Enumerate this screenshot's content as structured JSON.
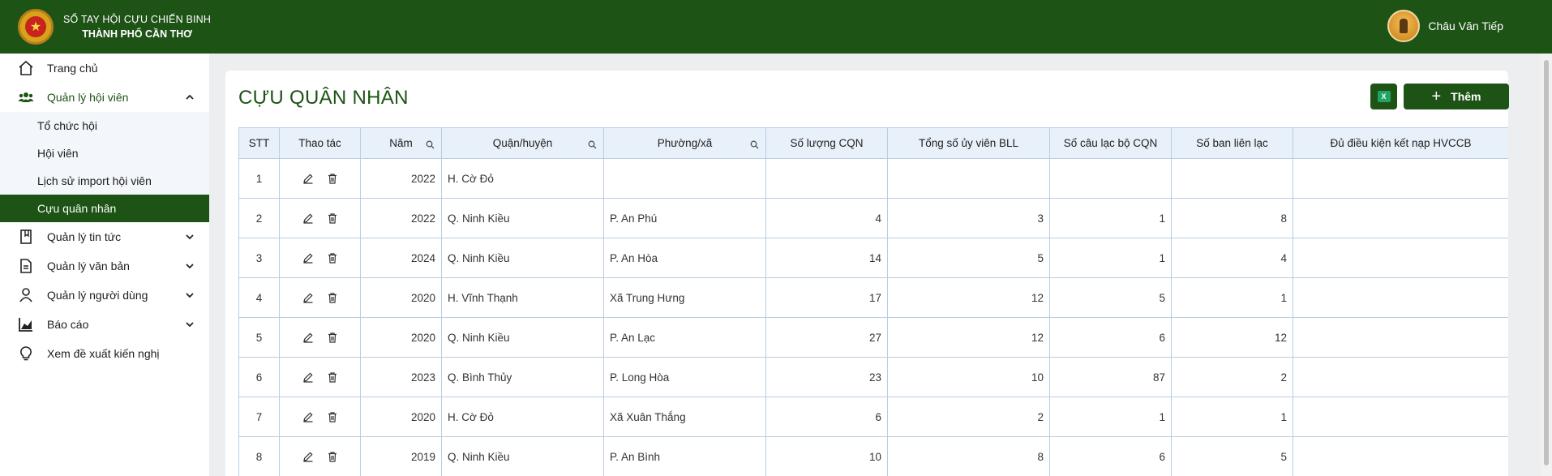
{
  "header": {
    "brand_line1": "SỔ TAY HỘI CỰU CHIẾN BINH",
    "brand_line2": "THÀNH PHỐ CẦN THƠ",
    "user_name": "Châu Văn Tiếp",
    "accent_color": "#1e5316"
  },
  "sidebar": {
    "items": [
      {
        "label": "Trang chủ",
        "icon": "home-icon"
      },
      {
        "label": "Quản lý hội viên",
        "icon": "users-icon",
        "expanded": true
      },
      {
        "label": "Quản lý tin tức",
        "icon": "book-icon"
      },
      {
        "label": "Quản lý văn bản",
        "icon": "document-icon"
      },
      {
        "label": "Quản lý người dùng",
        "icon": "user-icon"
      },
      {
        "label": "Báo cáo",
        "icon": "chart-icon"
      },
      {
        "label": "Xem đề xuất kiến nghị",
        "icon": "lightbulb-icon"
      }
    ],
    "sub_items": [
      {
        "label": "Tổ chức hội"
      },
      {
        "label": "Hội viên"
      },
      {
        "label": "Lịch sử import hội viên"
      },
      {
        "label": "Cựu quân nhân",
        "active": true
      }
    ]
  },
  "main": {
    "title": "CỰU QUÂN NHÂN",
    "add_label": "Thêm",
    "excel_icon": "excel-icon"
  },
  "table": {
    "headers": [
      "STT",
      "Thao tác",
      "Năm",
      "Quận/huyện",
      "Phường/xã",
      "Số lượng CQN",
      "Tổng số ủy viên BLL",
      "Số câu lạc bộ CQN",
      "Số ban liên lạc",
      "Đủ điều kiện kết nạp HVCCB"
    ],
    "rows": [
      [
        "1",
        "",
        "2022",
        "H. Cờ Đỏ",
        "",
        "",
        "",
        "",
        "",
        ""
      ],
      [
        "2",
        "",
        "2022",
        "Q. Ninh Kiều",
        "P. An Phú",
        "4",
        "3",
        "1",
        "8",
        ""
      ],
      [
        "3",
        "",
        "2024",
        "Q. Ninh Kiều",
        "P. An Hòa",
        "14",
        "5",
        "1",
        "4",
        ""
      ],
      [
        "4",
        "",
        "2020",
        "H. Vĩnh Thạnh",
        "Xã Trung Hưng",
        "17",
        "12",
        "5",
        "1",
        ""
      ],
      [
        "5",
        "",
        "2020",
        "Q. Ninh Kiều",
        "P. An Lạc",
        "27",
        "12",
        "6",
        "12",
        ""
      ],
      [
        "6",
        "",
        "2023",
        "Q. Bình Thủy",
        "P. Long Hòa",
        "23",
        "10",
        "87",
        "2",
        ""
      ],
      [
        "7",
        "",
        "2020",
        "H. Cờ Đỏ",
        "Xã Xuân Thắng",
        "6",
        "2",
        "1",
        "1",
        ""
      ],
      [
        "8",
        "",
        "2019",
        "Q. Ninh Kiều",
        "P. An Bình",
        "10",
        "8",
        "6",
        "5",
        ""
      ]
    ]
  }
}
